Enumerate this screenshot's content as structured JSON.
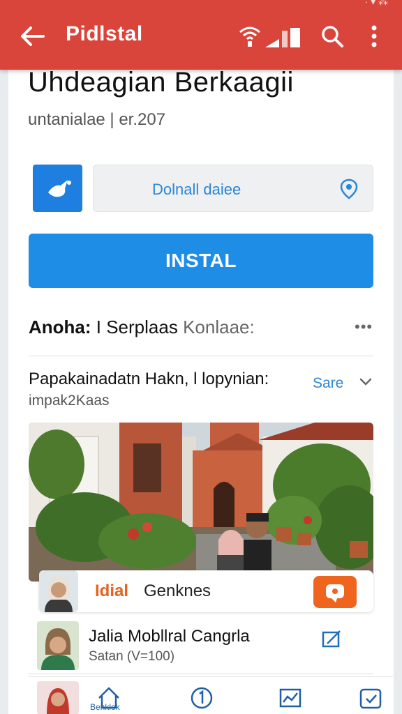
{
  "status_bar": {
    "text": "· ▾ ⁂"
  },
  "appbar": {
    "title": "Pidlstal",
    "icons": [
      "back-arrow-icon",
      "signal-icon",
      "cell-bars-icon",
      "search-icon",
      "more-vert-icon"
    ],
    "color": "#d9453b"
  },
  "app": {
    "title": "Uhdeagian Berkaagii",
    "subtitle": "untanialae | er.207"
  },
  "date_field": {
    "label": "Dolnall daiee",
    "icon": "location-pin-icon"
  },
  "install_button": {
    "label": "INSTAL",
    "color": "#1e8de6"
  },
  "section1": {
    "title_bold": "Anoha:",
    "title_mid": " I Serplaas",
    "title_light": " Konlaae:",
    "more": "•••"
  },
  "section2": {
    "title": "Papakainadatn Hakn, l lopynian:",
    "subtitle": "impak2Kaas",
    "link": "Sare"
  },
  "overlay": {
    "highlight": "Idial",
    "name": "Genknes",
    "accent": "#f0651e"
  },
  "row2": {
    "title": "Jalia Mobllral Cangrla",
    "subtitle": "Satan (V=100)"
  },
  "bottom_nav": {
    "label": "Benklok",
    "items": [
      "home-icon",
      "info-circle-icon",
      "chart-icon",
      "calendar-check-icon"
    ]
  }
}
